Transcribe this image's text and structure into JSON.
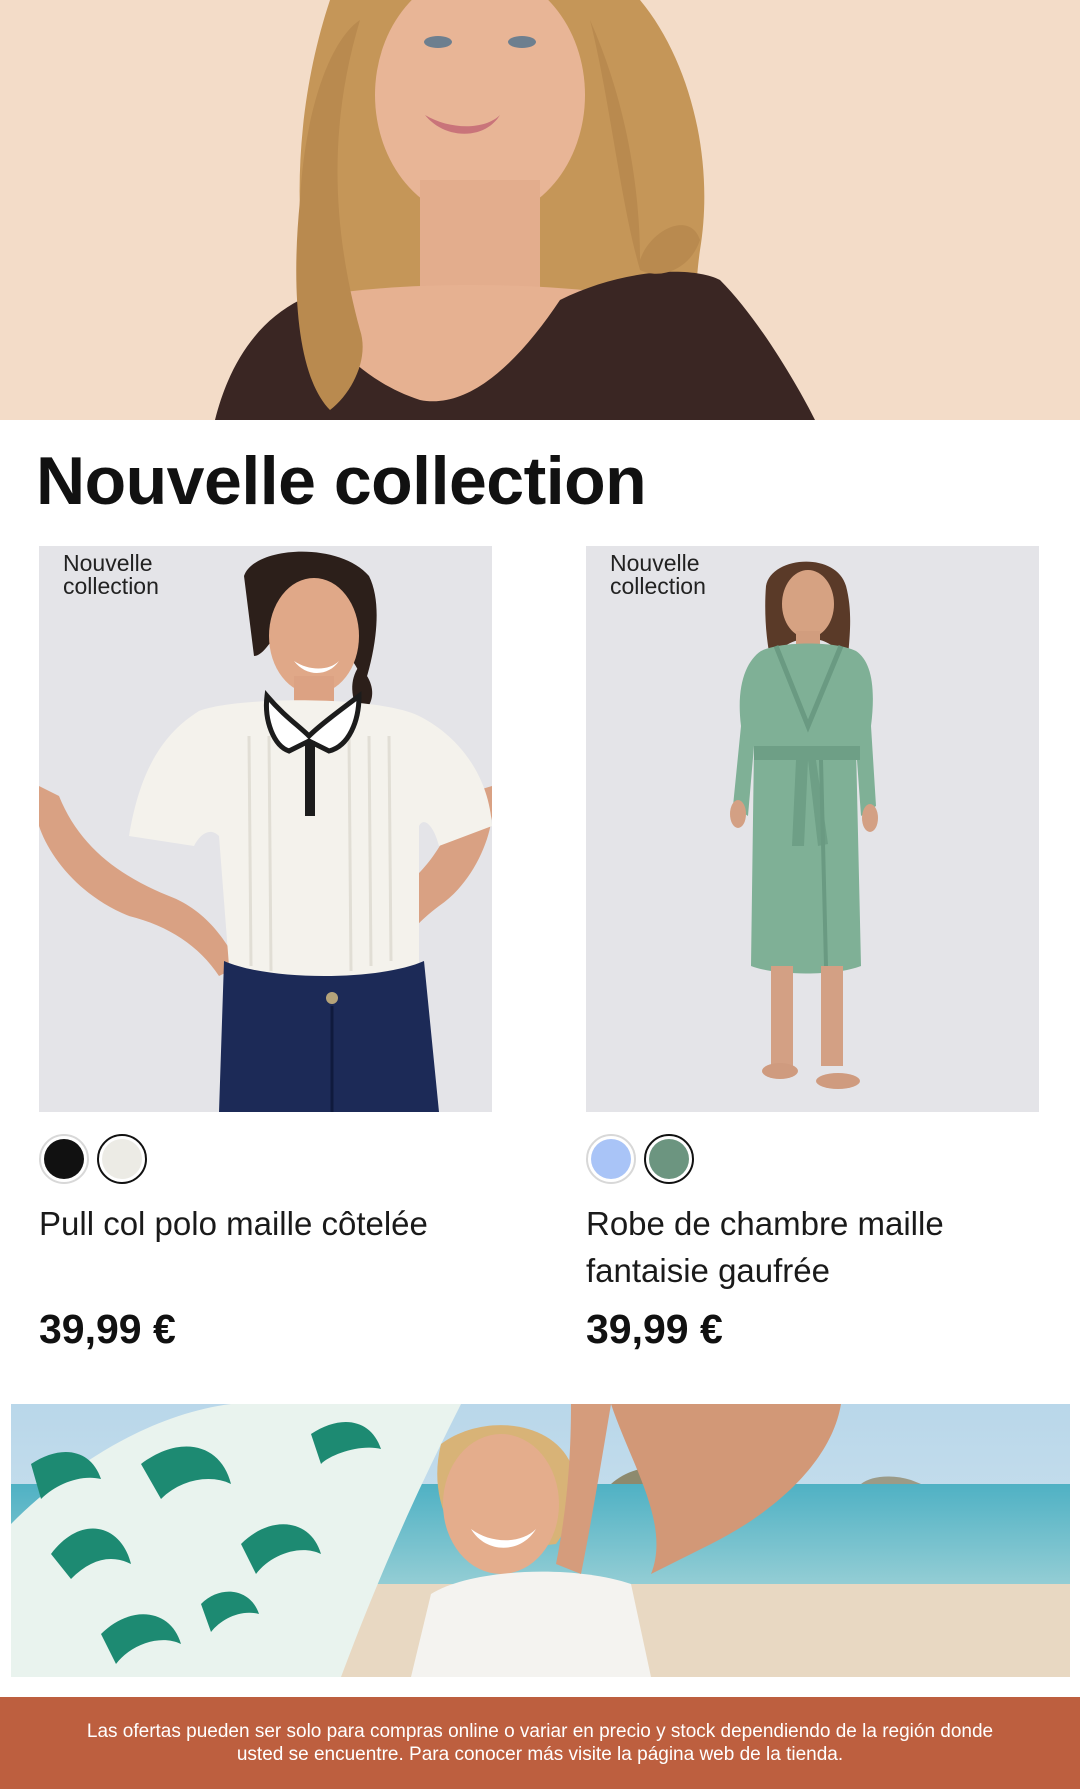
{
  "hero": {
    "image_alt": "Woman with long blonde hair wearing a brown knit top",
    "colors": {
      "background": "#f3dcc8",
      "top": "#3a2623",
      "hair": "#c89a5e",
      "skin": "#e9b89a"
    }
  },
  "section": {
    "title": "Nouvelle collection"
  },
  "products": [
    {
      "badge_line1": "Nouvelle",
      "badge_line2": "collection",
      "image_alt": "Woman in white ribbed polo sweater with navy jeans",
      "swatches": [
        {
          "color": "#111111",
          "selected": false
        },
        {
          "color": "#ecebe5",
          "selected": true
        }
      ],
      "name": "Pull col polo maille côtelée",
      "price": "39,99 €"
    },
    {
      "badge_line1": "Nouvelle",
      "badge_line2": "collection",
      "image_alt": "Woman in sage green belted knit robe",
      "swatches": [
        {
          "color": "#a9c4f7",
          "selected": false
        },
        {
          "color": "#6c9580",
          "selected": true
        }
      ],
      "name": "Robe de chambre maille fantaisie gaufrée",
      "price": "39,99 €"
    }
  ],
  "banner": {
    "image_alt": "Smiling woman on a beach holding a green tropical print scarf"
  },
  "footer": {
    "disclaimer": "Las ofertas pueden ser solo para compras online o variar en precio y stock dependiendo de la región donde usted se encuentre. Para conocer más visite la página web de la tienda.",
    "background": "#bd5f3f"
  }
}
